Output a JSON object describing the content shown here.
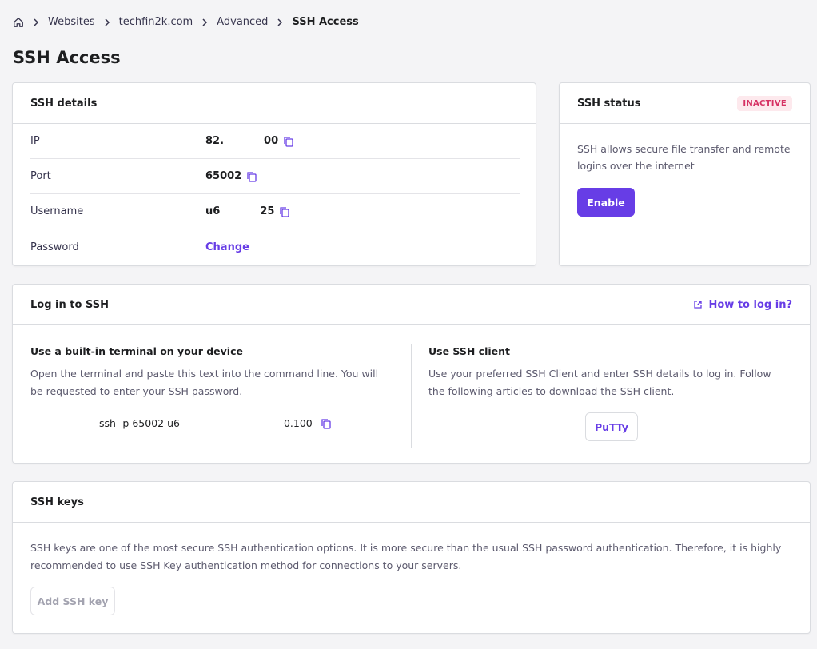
{
  "breadcrumb": {
    "items": [
      "Websites",
      "techfin2k.com",
      "Advanced"
    ],
    "current": "SSH Access"
  },
  "page": {
    "title": "SSH Access"
  },
  "ssh_details": {
    "title": "SSH details",
    "rows": [
      {
        "label": "IP",
        "value_start": "82.",
        "value_end": "00"
      },
      {
        "label": "Port",
        "value": "65002"
      },
      {
        "label": "Username",
        "value_start": "u6",
        "value_end": "25"
      },
      {
        "label": "Password",
        "action": "Change"
      }
    ]
  },
  "ssh_status": {
    "title": "SSH status",
    "badge": "INACTIVE",
    "description": "SSH allows secure file transfer and remote logins over the internet",
    "enable_label": "Enable"
  },
  "login": {
    "title": "Log in to SSH",
    "how_link": "How to log in?",
    "terminal": {
      "title": "Use a built-in terminal on your device",
      "description": "Open the terminal and paste this text into the command line. You will be requested to enter your SSH password.",
      "command_start": "ssh -p 65002 u6",
      "command_end": "0.100"
    },
    "client": {
      "title": "Use SSH client",
      "description": "Use your preferred SSH Client and enter SSH details to log in. Follow the following articles to download the SSH client.",
      "putty_label": "PuTTy"
    }
  },
  "ssh_keys": {
    "title": "SSH keys",
    "description": "SSH keys are one of the most secure SSH authentication options. It is more secure than the usual SSH password authentication. Therefore, it is highly recommended to use SSH Key authentication method for connections to your servers.",
    "add_label": "Add SSH key"
  },
  "colors": {
    "accent": "#673de6",
    "badge_bg": "#fde9ed",
    "badge_text": "#d63163",
    "background": "#f4f4f6"
  },
  "icons": {
    "home": "home-icon",
    "chevron": "chevron-right-icon",
    "copy": "copy-icon",
    "external": "external-link-icon"
  }
}
